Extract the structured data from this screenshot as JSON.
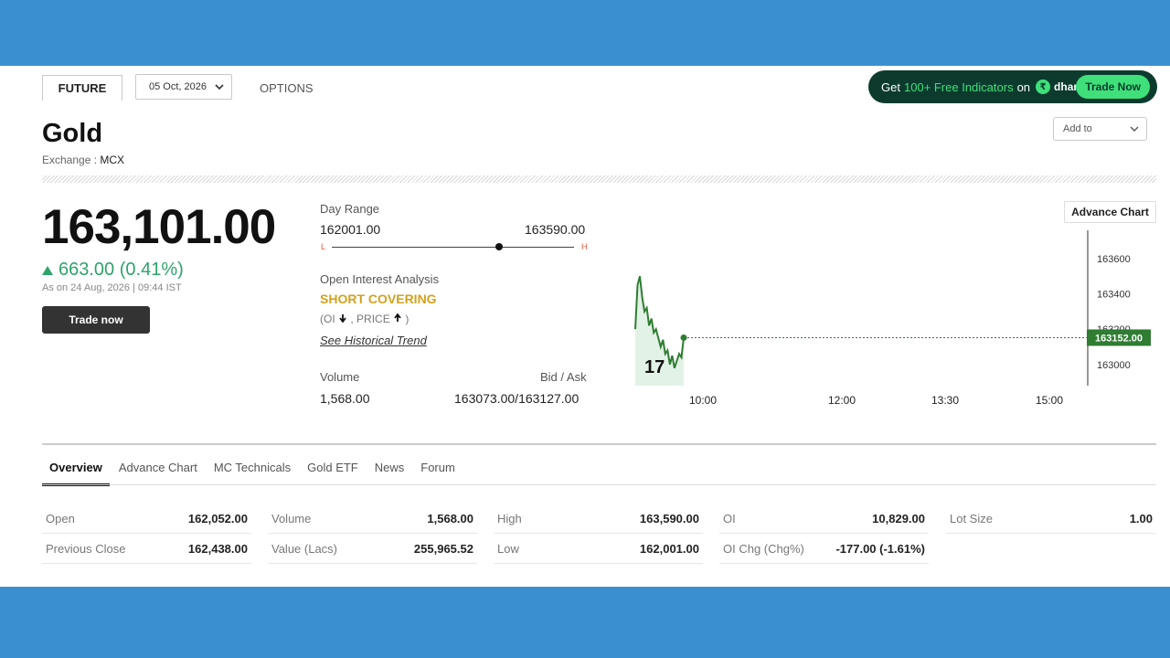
{
  "header": {
    "future_tab": "FUTURE",
    "expiry": "05 Oct, 2026",
    "options_tab": "OPTIONS",
    "promo": {
      "prefix": "Get",
      "highlight": "100+ Free Indicators",
      "suffix": "on",
      "brand": "dhan",
      "button": "Trade Now"
    },
    "add_to": "Add to"
  },
  "instrument": {
    "name": "Gold",
    "exchange_label": "Exchange :",
    "exchange": "MCX",
    "price": "163,101.00",
    "change": "663.00 (0.41%)",
    "as_on": "As on 24 Aug, 2026 | 09:44 IST",
    "trade_button": "Trade now"
  },
  "day_range": {
    "label": "Day Range",
    "low": "162001.00",
    "high": "163590.00",
    "low_tag": "L",
    "high_tag": "H",
    "position_fraction": 0.69
  },
  "oi_analysis": {
    "label": "Open Interest Analysis",
    "status": "SHORT COVERING",
    "detail_oi": "(OI",
    "detail_price": ", PRICE",
    "detail_close": ")",
    "trend_link": "See Historical Trend"
  },
  "volume": {
    "label": "Volume",
    "value": "1,568.00"
  },
  "bid_ask": {
    "label": "Bid / Ask",
    "value": "163073.00/163127.00"
  },
  "chart": {
    "advance_button": "Advance Chart",
    "current_label": "163152.00",
    "watermark": "17"
  },
  "chart_data": {
    "type": "line",
    "title": "",
    "x_ticks": [
      "10:00",
      "12:00",
      "13:30",
      "15:00"
    ],
    "y_ticks": [
      163600,
      163400,
      163200,
      163000
    ],
    "ylim": [
      162880,
      163760
    ],
    "current": 163152,
    "series": [
      {
        "values": [
          163200,
          163450,
          163500,
          163380,
          163300,
          163320,
          163220,
          163260,
          163180,
          163200,
          163150,
          163100,
          163140,
          163060,
          163080,
          163000,
          163050,
          162980,
          163020,
          163060,
          163040,
          163152
        ]
      }
    ],
    "colors": {
      "line": "#2e7d32",
      "area": "#e3f2e6",
      "current_bg": "#2e7d32"
    }
  },
  "tabs": [
    {
      "label": "Overview",
      "active": true
    },
    {
      "label": "Advance Chart",
      "active": false
    },
    {
      "label": "MC Technicals",
      "active": false
    },
    {
      "label": "Gold ETF",
      "active": false
    },
    {
      "label": "News",
      "active": false
    },
    {
      "label": "Forum",
      "active": false
    }
  ],
  "stats": [
    [
      {
        "k": "Open",
        "v": "162,052.00"
      },
      {
        "k": "Previous Close",
        "v": "162,438.00"
      }
    ],
    [
      {
        "k": "Volume",
        "v": "1,568.00"
      },
      {
        "k": "Value (Lacs)",
        "v": "255,965.52"
      }
    ],
    [
      {
        "k": "High",
        "v": "163,590.00"
      },
      {
        "k": "Low",
        "v": "162,001.00"
      }
    ],
    [
      {
        "k": "OI",
        "v": "10,829.00"
      },
      {
        "k": "OI Chg (Chg%)",
        "v": "-177.00 (-1.61%)"
      }
    ],
    [
      {
        "k": "Lot Size",
        "v": "1.00"
      }
    ]
  ]
}
